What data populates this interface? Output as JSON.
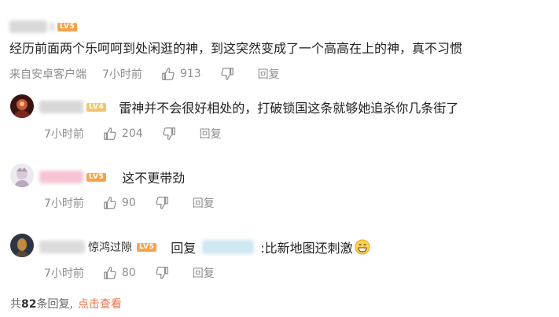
{
  "main_comment": {
    "level_badge": "LV5",
    "text": "经历前面两个乐呵呵到处闲逛的神，到这突然变成了一个高高在上的神，真不习惯",
    "source": "来自安卓客户端",
    "time": "7小时前",
    "likes": "913",
    "reply_label": "回复"
  },
  "replies": [
    {
      "level_badge": "LV4",
      "text": "雷神并不会很好相处的，打破锁国这条就够她追杀你几条街了",
      "time": "7小时前",
      "likes": "204",
      "reply_label": "回复"
    },
    {
      "level_badge": "LV5",
      "text": "这不更带劲",
      "time": "7小时前",
      "likes": "90",
      "reply_label": "回复"
    },
    {
      "username_suffix": "惊鸿过隙",
      "level_badge": "LV5",
      "reply_prefix": "回复",
      "text": ":比新地图还刺激",
      "time": "7小时前",
      "likes": "80",
      "reply_label": "回复"
    }
  ],
  "footer": {
    "prefix": "共",
    "count": "82",
    "suffix": "条回复,",
    "link": "点击查看"
  },
  "colors": {
    "level_badge": "#f7a24b",
    "level_badge_lv4": "#f3c46f",
    "link": "#eb7350",
    "meta_text": "#8e8e8e"
  },
  "icons": {
    "like": "thumbs-up-icon",
    "dislike": "thumbs-down-icon",
    "emoji": "grinning-face-emoji"
  }
}
